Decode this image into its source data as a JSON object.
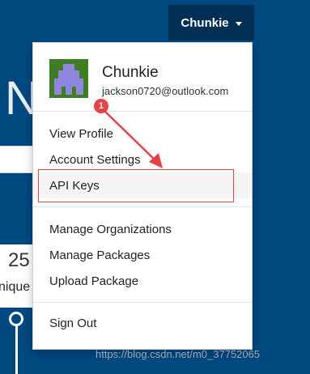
{
  "background": {
    "heading_fragment": "N",
    "stat_number": "25",
    "stat_label": "nique"
  },
  "nav": {
    "user_button_label": "Chunkie",
    "caret_icon": "chevron-down-icon"
  },
  "dropdown": {
    "profile": {
      "name": "Chunkie",
      "email": "jackson0720@outlook.com"
    },
    "items": [
      {
        "label": "View Profile"
      },
      {
        "label": "Account Settings"
      },
      {
        "label": "API Keys"
      },
      {
        "label": "Manage Organizations"
      },
      {
        "label": "Manage Packages"
      },
      {
        "label": "Upload Package"
      },
      {
        "label": "Sign Out"
      }
    ]
  },
  "annotation": {
    "badge_number": "1",
    "color": "#e3424a"
  },
  "watermark": "https://blog.csdn.net/m0_37752065",
  "colors": {
    "page_background": "#004880",
    "nav_button": "#002f55",
    "avatar": "#3f7d25",
    "avatar_figure": "#8f86e0"
  }
}
